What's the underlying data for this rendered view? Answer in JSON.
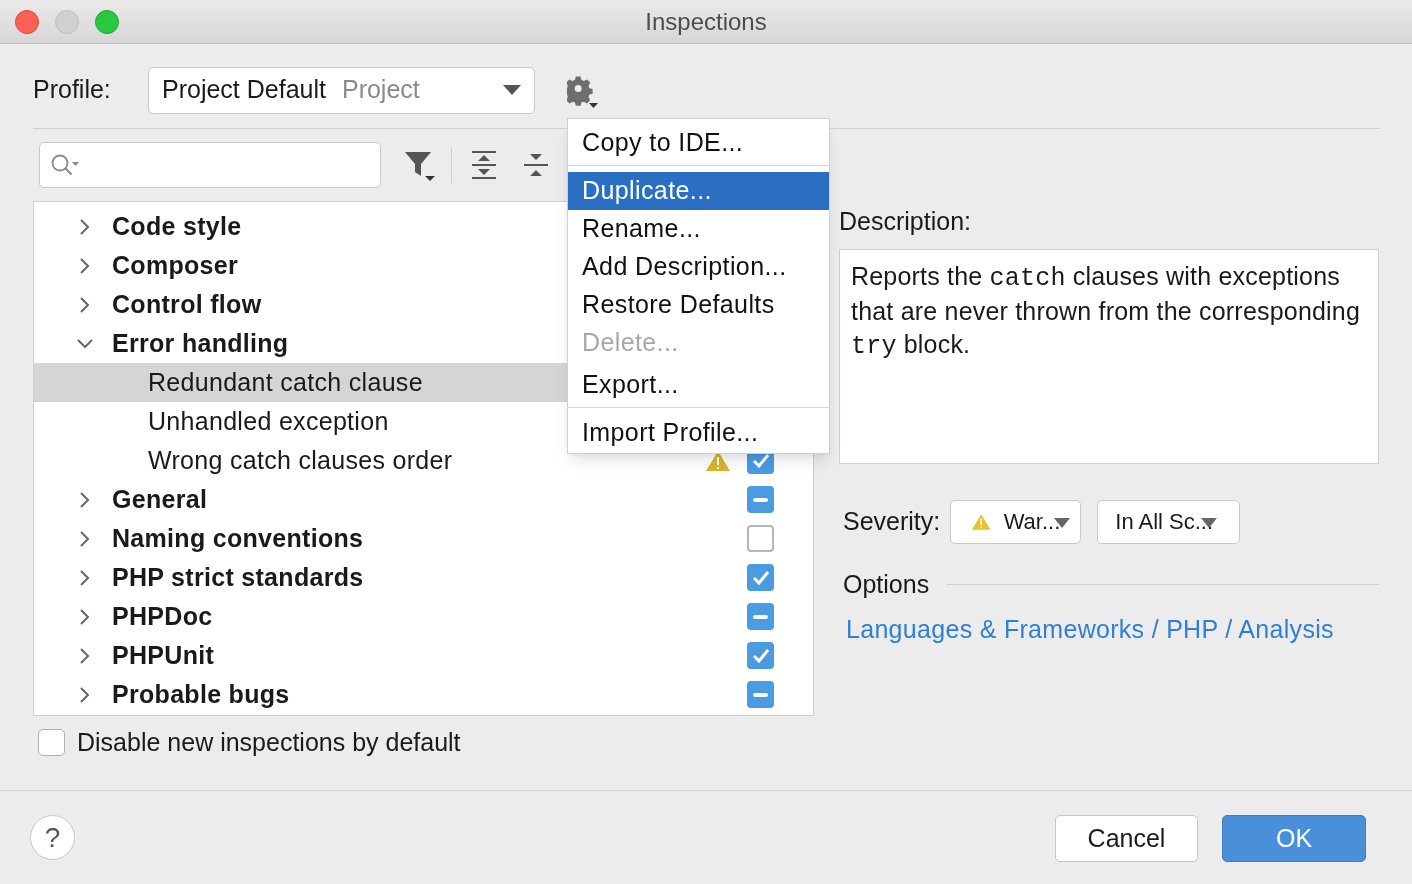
{
  "window": {
    "title": "Inspections"
  },
  "profile": {
    "label": "Profile:",
    "value": "Project Default",
    "scope": "Project"
  },
  "tree": [
    {
      "label": "Code style",
      "expanded": false,
      "selected": false
    },
    {
      "label": "Composer",
      "expanded": false,
      "selected": false
    },
    {
      "label": "Control flow",
      "expanded": false,
      "selected": false
    },
    {
      "label": "Error handling",
      "expanded": true,
      "selected": false,
      "children": [
        {
          "label": "Redundant catch clause",
          "selected": true
        },
        {
          "label": "Unhandled exception",
          "selected": false
        },
        {
          "label": "Wrong catch clauses order",
          "selected": false,
          "warning": true,
          "checked": true
        }
      ]
    },
    {
      "label": "General",
      "expanded": false,
      "selected": false,
      "mixed": true
    },
    {
      "label": "Naming conventions",
      "expanded": false,
      "selected": false,
      "checked": false
    },
    {
      "label": "PHP strict standards",
      "expanded": false,
      "selected": false,
      "checked": true
    },
    {
      "label": "PHPDoc",
      "expanded": false,
      "selected": false,
      "mixed": true
    },
    {
      "label": "PHPUnit",
      "expanded": false,
      "selected": false,
      "checked": true
    },
    {
      "label": "Probable bugs",
      "expanded": false,
      "selected": false,
      "mixed": true
    }
  ],
  "disable_new": {
    "label": "Disable new inspections by default",
    "checked": false
  },
  "menu": [
    {
      "label": "Copy to IDE...",
      "selected": false,
      "disabled": false,
      "separator_after": true
    },
    {
      "label": "Duplicate...",
      "selected": true,
      "disabled": false,
      "separator_after": false
    },
    {
      "label": "Rename...",
      "selected": false,
      "disabled": false,
      "separator_after": false
    },
    {
      "label": "Add Description...",
      "selected": false,
      "disabled": false,
      "separator_after": false
    },
    {
      "label": "Restore Defaults",
      "selected": false,
      "disabled": false,
      "separator_after": false
    },
    {
      "label": "Delete...",
      "selected": false,
      "disabled": true,
      "separator_after": false
    },
    {
      "label": "Export...",
      "selected": false,
      "disabled": false,
      "separator_after": true
    },
    {
      "label": "Import Profile...",
      "selected": false,
      "disabled": false,
      "separator_after": false
    }
  ],
  "description": {
    "label": "Description:",
    "segments": [
      {
        "text": "Reports the ",
        "code": false
      },
      {
        "text": "catch",
        "code": true
      },
      {
        "text": " clauses with exceptions that are never thrown from the corresponding ",
        "code": false
      },
      {
        "text": "try",
        "code": true
      },
      {
        "text": " block.",
        "code": false
      }
    ]
  },
  "severity": {
    "label": "Severity:",
    "level_value": "War...",
    "scope_value": "In All Sc..."
  },
  "options": {
    "title": "Options",
    "link": "Languages & Frameworks / PHP / Analysis"
  },
  "buttons": {
    "help": "?",
    "cancel": "Cancel",
    "ok": "OK"
  }
}
